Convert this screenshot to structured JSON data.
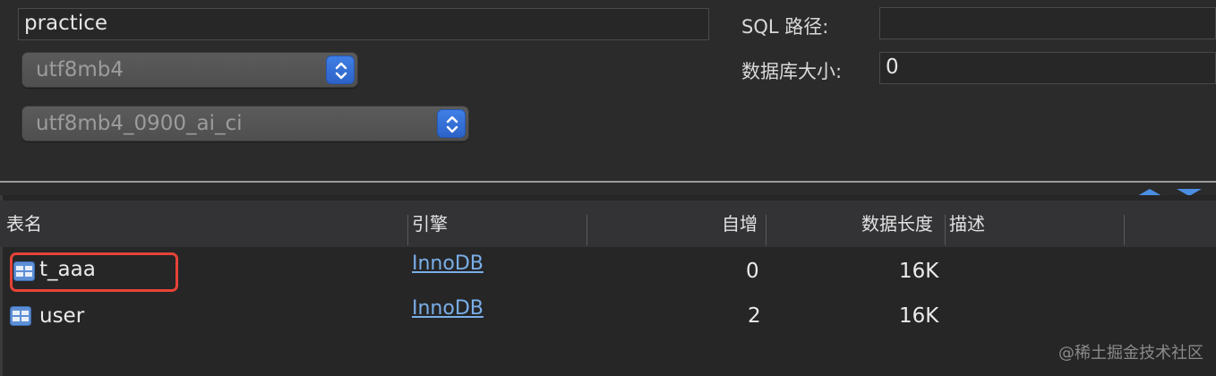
{
  "form": {
    "name_value": "practice",
    "charset_value": "utf8mb4",
    "collation_value": "utf8mb4_0900_ai_ci",
    "sql_path_label": "SQL 路径:",
    "sql_path_value": "",
    "db_size_label": "数据库大小:",
    "db_size_value": "0"
  },
  "table": {
    "headers": {
      "name": "表名",
      "engine": "引擎",
      "auto_increment": "自增",
      "data_length": "数据长度",
      "description": "描述"
    },
    "rows": [
      {
        "name": "t_aaa",
        "engine": "InnoDB",
        "auto_increment": "0",
        "data_length": "16K",
        "description": "",
        "highlighted": true
      },
      {
        "name": "user",
        "engine": "InnoDB",
        "auto_increment": "2",
        "data_length": "16K",
        "description": "",
        "highlighted": false
      }
    ]
  },
  "icons": {
    "table": "table-icon",
    "stepper": "up-down-stepper-icon",
    "scroll": "scroll-up-down-icon"
  },
  "colors": {
    "accent": "#2d63c9",
    "link": "#7aaee8",
    "highlight": "#e64336"
  },
  "watermark": "@稀土掘金技术社区"
}
